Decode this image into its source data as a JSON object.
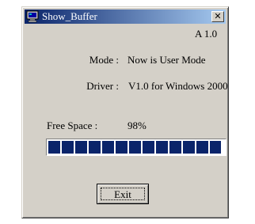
{
  "window": {
    "title": "Show_Buffer",
    "app_icon": "monitor-icon",
    "close_glyph": "✕",
    "version": "A 1.0"
  },
  "fields": {
    "mode_label": "Mode :",
    "mode_value": "Now is User Mode",
    "driver_label": "Driver :",
    "driver_value": "V1.0 for Windows 2000",
    "free_space_label": "Free Space :",
    "free_space_value": "98%"
  },
  "progress": {
    "percent": 98,
    "color": "#0a246a"
  },
  "buttons": {
    "exit_label": "Exit"
  },
  "colors": {
    "titlebar_start": "#0a246a",
    "titlebar_end": "#a6caf0",
    "face": "#d4d0c8"
  }
}
